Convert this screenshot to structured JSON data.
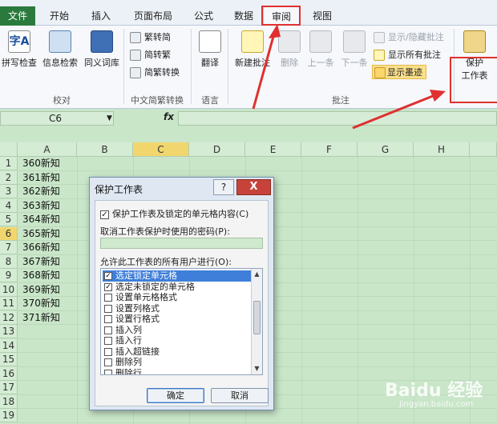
{
  "tabs": [
    "文件",
    "开始",
    "插入",
    "页面布局",
    "公式",
    "数据",
    "审阅",
    "视图"
  ],
  "ribbon": {
    "proofing": {
      "label": "校对",
      "spell": "拼写检查",
      "research": "信息检索",
      "thesaurus": "同义词库"
    },
    "chinese": {
      "label": "中文简繁转换",
      "to_trad": "繁转简",
      "to_simp": "简转繁",
      "convert": "简繁转换"
    },
    "language": {
      "label": "语言",
      "translate": "翻译"
    },
    "comments": {
      "label": "批注",
      "new": "新建批注",
      "delete": "删除",
      "prev": "上一条",
      "next": "下一条",
      "show_hide": "显示/隐藏批注",
      "show_all": "显示所有批注",
      "show_ink": "显示墨迹"
    },
    "changes": {
      "protect_line1": "保护",
      "protect_line2": "工作表"
    }
  },
  "formula_bar": {
    "name_box": "C6",
    "fx": "fx",
    "value": ""
  },
  "grid": {
    "columns": [
      "A",
      "B",
      "C",
      "D",
      "E",
      "F",
      "G",
      "H"
    ],
    "selected_column": "C",
    "rows": [
      "1",
      "2",
      "3",
      "4",
      "5",
      "6",
      "7",
      "8",
      "9",
      "10",
      "11",
      "12",
      "13",
      "14",
      "15",
      "16",
      "17",
      "18",
      "19"
    ],
    "selected_row": "6",
    "col_a": [
      "360新知",
      "361新知",
      "362新知",
      "363新知",
      "364新知",
      "365新知",
      "366新知",
      "367新知",
      "368新知",
      "369新知",
      "370新知",
      "371新知"
    ]
  },
  "dialog": {
    "title": "保护工作表",
    "help": "?",
    "close": "X",
    "protect_label": "保护工作表及锁定的单元格内容(C)",
    "password_label": "取消工作表保护时使用的密码(P):",
    "allow_label": "允许此工作表的所有用户进行(O):",
    "options": [
      {
        "label": "选定锁定单元格",
        "checked": true
      },
      {
        "label": "选定未锁定的单元格",
        "checked": true
      },
      {
        "label": "设置单元格格式",
        "checked": false
      },
      {
        "label": "设置列格式",
        "checked": false
      },
      {
        "label": "设置行格式",
        "checked": false
      },
      {
        "label": "插入列",
        "checked": false
      },
      {
        "label": "插入行",
        "checked": false
      },
      {
        "label": "插入超链接",
        "checked": false
      },
      {
        "label": "删除列",
        "checked": false
      },
      {
        "label": "删除行",
        "checked": false
      }
    ],
    "ok": "确定",
    "cancel": "取消"
  },
  "watermark": {
    "brand": "Baidu 经验",
    "url": "jingyan.baidu.com"
  },
  "colors": {
    "file_tab": "#2b7a3d",
    "highlight": "#e03030",
    "sheet_bg": "#c9e6c9",
    "selection": "#3f7fd9"
  }
}
